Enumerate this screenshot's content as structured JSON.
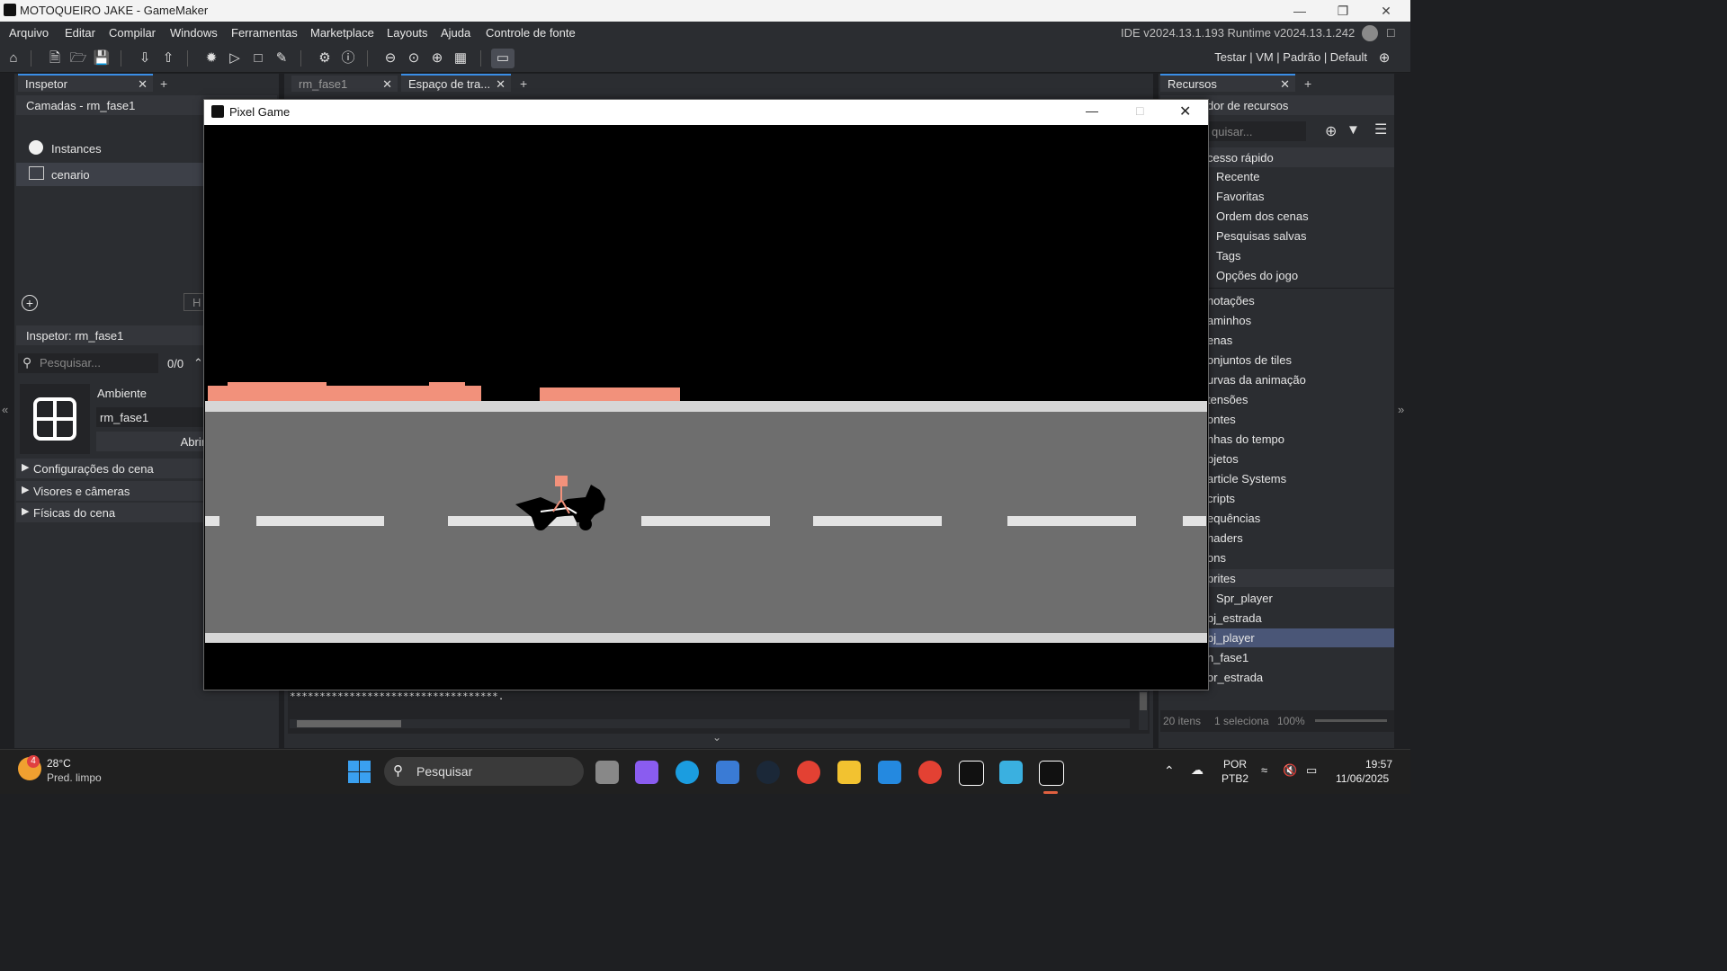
{
  "window": {
    "title": "MOTOQUEIRO JAKE - GameMaker"
  },
  "menu": {
    "items": [
      "Arquivo",
      "Editar",
      "Compilar",
      "Windows",
      "Ferramentas",
      "Marketplace",
      "Layouts",
      "Ajuda",
      "Controle de fonte"
    ]
  },
  "version": "IDE v2024.13.1.193  Runtime v2024.13.1.242",
  "targets": "Testar | VM | Padrão | Default",
  "left_panel": {
    "tab_label": "Inspetor",
    "layers_title": "Camadas - rm_fase1",
    "layers": [
      "Instances",
      "cenario"
    ],
    "hint_btn": "H",
    "inspector_title": "Inspetor: rm_fase1",
    "search_placeholder": "Pesquisar...",
    "search_count": "0/0",
    "ambiente_label": "Ambiente",
    "room_name": "rm_fase1",
    "open_editor": "Abrir o Edi",
    "sections": [
      "Configurações do cena",
      "Visores e câmeras",
      "Físicas do cena"
    ]
  },
  "center": {
    "tabs": [
      "rm_fase1",
      "Espaço de tra..."
    ],
    "output_text": "***********************************."
  },
  "game_window": {
    "title": "Pixel Game"
  },
  "right_panel": {
    "tab_label": "Recursos",
    "browser_title": "dor de recursos",
    "search_placeholder": "quisar...",
    "quick_access": "cesso rápido",
    "quick_items": [
      "Recente",
      "Favoritas",
      "Ordem dos cenas",
      "Pesquisas salvas",
      "Tags",
      "Opções do jogo"
    ],
    "groups": [
      "notações",
      "aminhos",
      "enas",
      "onjuntos de tiles",
      "urvas da animação",
      "tensões",
      "ontes",
      "nhas do tempo",
      "bjetos",
      "article Systems",
      "cripts",
      "equências",
      "haders",
      "ons"
    ],
    "sprites_group": "prites",
    "sprite_child": "Spr_player",
    "assets": [
      "bj_estrada",
      "bj_player",
      "n_fase1",
      "or_estrada"
    ],
    "footer_count": "20 itens",
    "footer_selected": "1 seleciona",
    "zoom": "100%"
  },
  "taskbar": {
    "weather_temp": "28°C",
    "weather_desc": "Pred. limpo",
    "weather_badge": "4",
    "search": "Pesquisar",
    "lang1": "POR",
    "lang2": "PTB2",
    "time": "19:57",
    "date": "11/06/2025"
  }
}
